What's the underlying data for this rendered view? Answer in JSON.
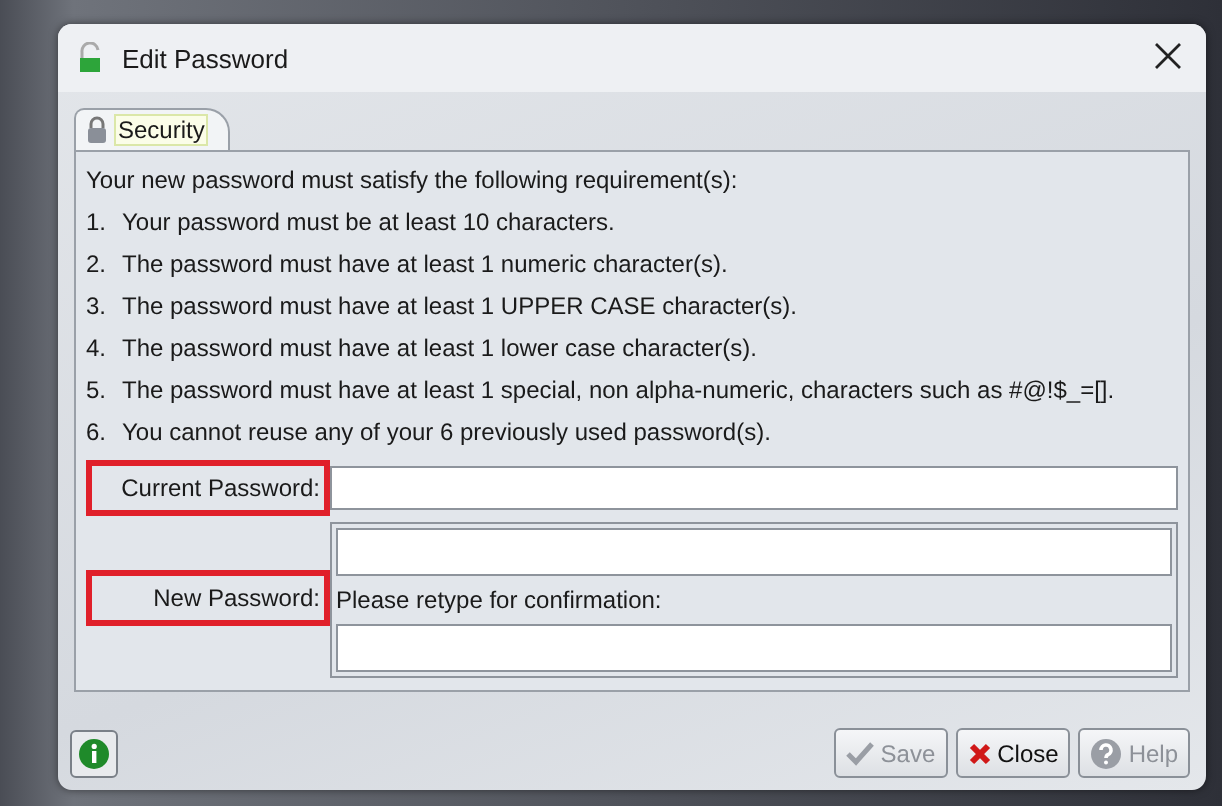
{
  "window": {
    "title": "Edit Password"
  },
  "tabs": [
    {
      "label": "Security",
      "selected": true
    }
  ],
  "intro": "Your new password must satisfy the following requirement(s):",
  "requirements": [
    {
      "number": "1.",
      "text": "Your password must be at least 10 characters."
    },
    {
      "number": "2.",
      "text": "The password must have at least 1 numeric character(s)."
    },
    {
      "number": "3.",
      "text": "The password must have at least 1 UPPER CASE character(s)."
    },
    {
      "number": "4.",
      "text": "The password must have at least 1 lower case character(s)."
    },
    {
      "number": "5.",
      "text": "The password must have at least 1 special, non alpha-numeric, characters such as #@!$_=[]."
    },
    {
      "number": "6.",
      "text": "You cannot reuse any of your 6 previously used password(s)."
    }
  ],
  "current_password": {
    "label": "Current Password:",
    "highlighted": true
  },
  "new_password": {
    "label": "New Password:",
    "highlighted": true,
    "confirm_label": "Please retype for confirmation:"
  },
  "buttons": [
    {
      "kind": "save",
      "label": "Save",
      "disabled": true
    },
    {
      "kind": "close",
      "label": "Close",
      "disabled": false
    },
    {
      "kind": "help",
      "label": "Help",
      "disabled": true
    }
  ]
}
